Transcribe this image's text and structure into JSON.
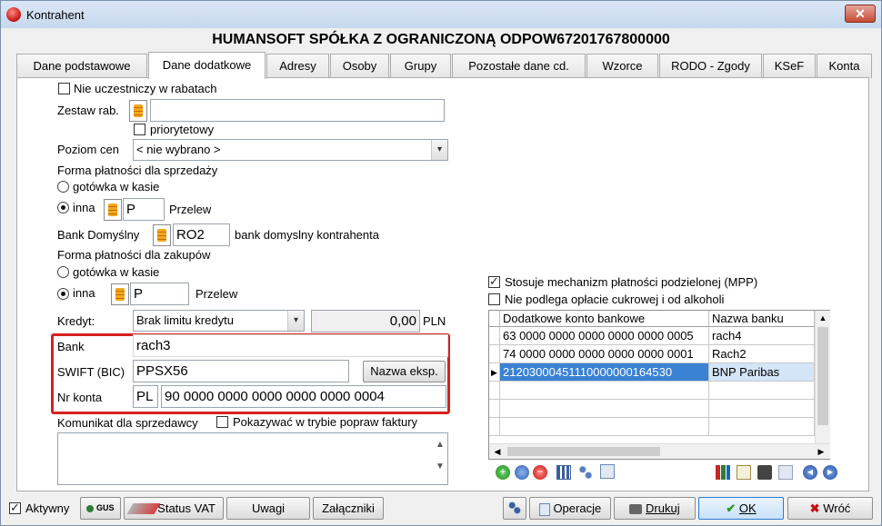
{
  "window": {
    "title": "Kontrahent",
    "close_label": "✕"
  },
  "company": "HUMANSOFT SPÓŁKA Z OGRANICZONĄ ODPOW67201767800000",
  "tabs": [
    {
      "label": "Dane podstawowe"
    },
    {
      "label": "Dane dodatkowe",
      "active": true
    },
    {
      "label": "Adresy"
    },
    {
      "label": "Osoby"
    },
    {
      "label": "Grupy"
    },
    {
      "label": "Pozostałe dane cd."
    },
    {
      "label": "Wzorce"
    },
    {
      "label": "RODO - Zgody"
    },
    {
      "label": "KSeF"
    },
    {
      "label": "Konta"
    }
  ],
  "form": {
    "no_discounts_label": "Nie uczestniczy w rabatach",
    "discount_set_label": "Zestaw rab.",
    "discount_set_value": "",
    "priority_label": "priorytetowy",
    "price_level_label": "Poziom cen",
    "price_level_value": "< nie wybrano >",
    "sales_payment_label": "Forma płatności dla sprzedaży",
    "sales_cash_label": "gotówka w kasie",
    "sales_other_label": "inna",
    "sales_payment_code": "P",
    "sales_payment_name": "Przelew",
    "default_bank_label": "Bank Domyślny",
    "default_bank_code": "RO2",
    "default_bank_desc": "bank domyslny kontrahenta",
    "purchase_payment_label": "Forma płatności dla zakupów",
    "purchase_cash_label": "gotówka w kasie",
    "purchase_other_label": "inna",
    "purchase_payment_code": "P",
    "purchase_payment_name": "Przelew",
    "credit_label": "Kredyt:",
    "credit_value": "Brak limitu kredytu",
    "credit_amount": "0,00",
    "credit_currency": "PLN",
    "bank_label": "Bank",
    "bank_value": "rach3",
    "swift_label": "SWIFT (BIC)",
    "swift_value": "PPSX56",
    "export_name_button": "Nazwa eksp.",
    "account_label": "Nr konta",
    "account_country": "PL",
    "account_number": "90 0000 0000 0000 0000 0000 0004",
    "sales_message_label": "Komunikat dla sprzedawcy",
    "show_in_invoice_label": "Pokazywać w trybie popraw faktury",
    "sales_message_value": ""
  },
  "right": {
    "mpp_label": "Stosuje mechanizm płatności podzielonej (MPP)",
    "mpp_checked": true,
    "sugar_label": "Nie podlega opłacie cukrowej i od alkoholi",
    "sugar_checked": false
  },
  "accounts_table": {
    "columns": [
      "Dodatkowe konto bankowe",
      "Nazwa banku"
    ],
    "rows": [
      {
        "account": "63 0000 0000 0000 0000 0000 0005",
        "bank": "rach4"
      },
      {
        "account": "74 0000 0000 0000 0000 0000 0001",
        "bank": "Rach2"
      },
      {
        "account": "21203000451110000000164530",
        "bank": "BNP Paribas",
        "selected": true
      }
    ]
  },
  "footer": {
    "active_label": "Aktywny",
    "gus_label": "GUS",
    "vat_status_label": "Status VAT",
    "notes_label": "Uwagi",
    "attachments_label": "Załączniki",
    "operations_label": "Operacje",
    "print_label": "Drukuj",
    "ok_label": "OK",
    "back_label": "Wróć"
  },
  "colors": {
    "highlight": "#d6211f",
    "selection": "#3a82d4",
    "accent": "#2a7bd6"
  }
}
